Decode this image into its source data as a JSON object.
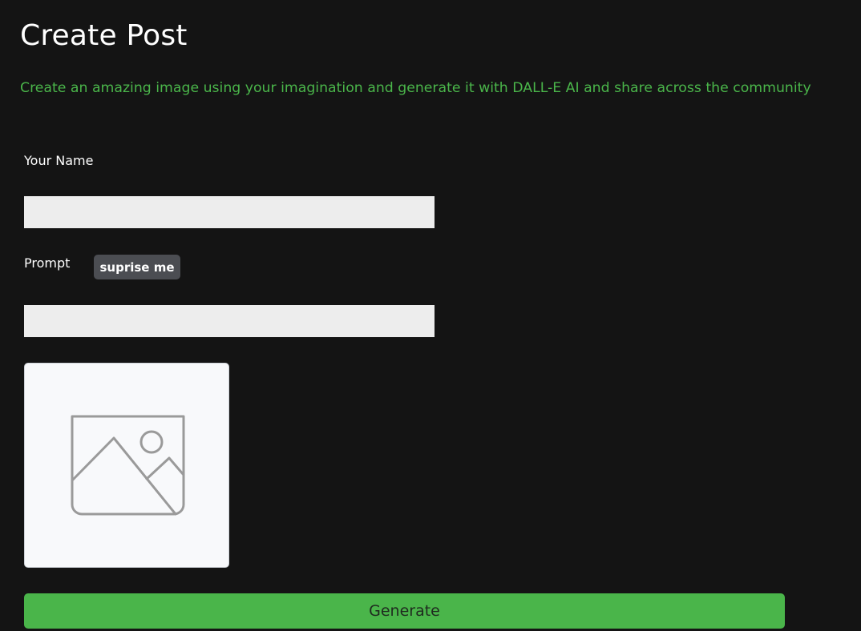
{
  "header": {
    "title": "Create Post",
    "subtitle": "Create an amazing image using your imagination and generate it with DALL-E AI and share across the community"
  },
  "form": {
    "name_label": "Your Name",
    "name_value": "",
    "prompt_label": "Prompt",
    "surprise_label": "suprise me",
    "prompt_value": "",
    "preview_icon": "image-placeholder-icon",
    "generate_label": "Generate"
  },
  "colors": {
    "background": "#141414",
    "accent": "#4ab54a",
    "input_bg": "#ededed",
    "secondary_button": "#4b4d52"
  }
}
